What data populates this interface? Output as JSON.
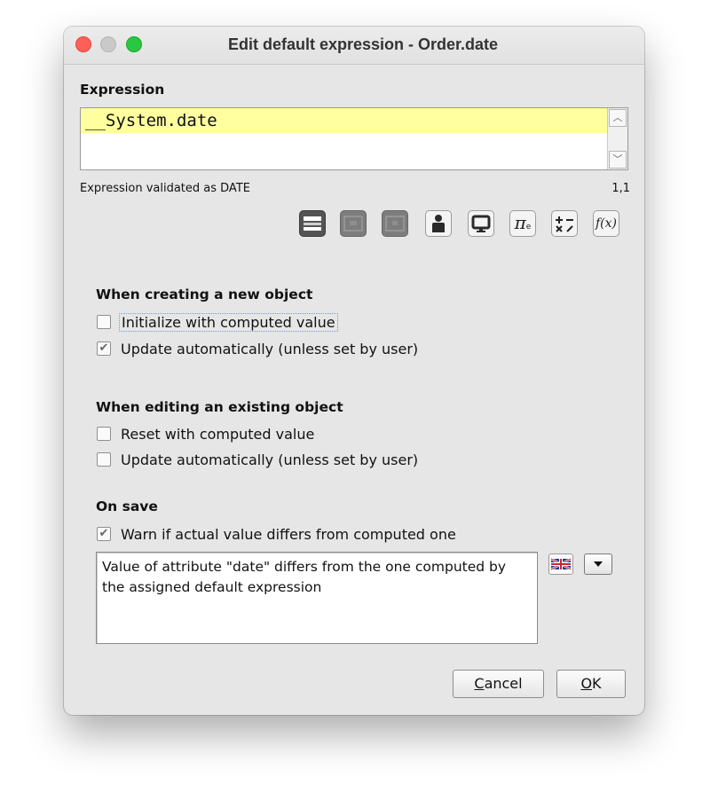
{
  "window": {
    "title": "Edit default expression - Order.date"
  },
  "expression": {
    "section_label": "Expression",
    "value": "__System.date",
    "status": "Expression validated as DATE",
    "cursor_position": "1,1"
  },
  "toolbar": {
    "icons": [
      "layout-icon",
      "table-icon",
      "schema-icon",
      "user-icon",
      "monitor-icon",
      "pi-constant-icon",
      "operators-icon",
      "function-icon"
    ],
    "pi_glyph": "π",
    "pi_sub": "e",
    "function_glyph": "f(x)"
  },
  "on_create": {
    "heading": "When creating a new object",
    "initialize_label": "Initialize with computed value",
    "initialize_checked": false,
    "update_label": "Update automatically (unless set by user)",
    "update_checked": true
  },
  "on_edit": {
    "heading": "When editing an existing object",
    "reset_label": "Reset with computed value",
    "reset_checked": false,
    "update_label": "Update automatically (unless set by user)",
    "update_checked": false
  },
  "on_save": {
    "heading": "On save",
    "warn_label": "Warn if actual value differs from computed one",
    "warn_checked": true,
    "message": "Value of attribute \"date\" differs from the one computed by the assigned default expression",
    "language_flag": "uk-flag-icon"
  },
  "buttons": {
    "cancel_mnemonic": "C",
    "cancel_rest": "ancel",
    "ok_mnemonic": "O",
    "ok_rest": "K"
  },
  "colors": {
    "expression_highlight": "#ffffa0",
    "window_bg": "#e6e6e6",
    "close": "#fe5f57",
    "maximize": "#28c840"
  }
}
